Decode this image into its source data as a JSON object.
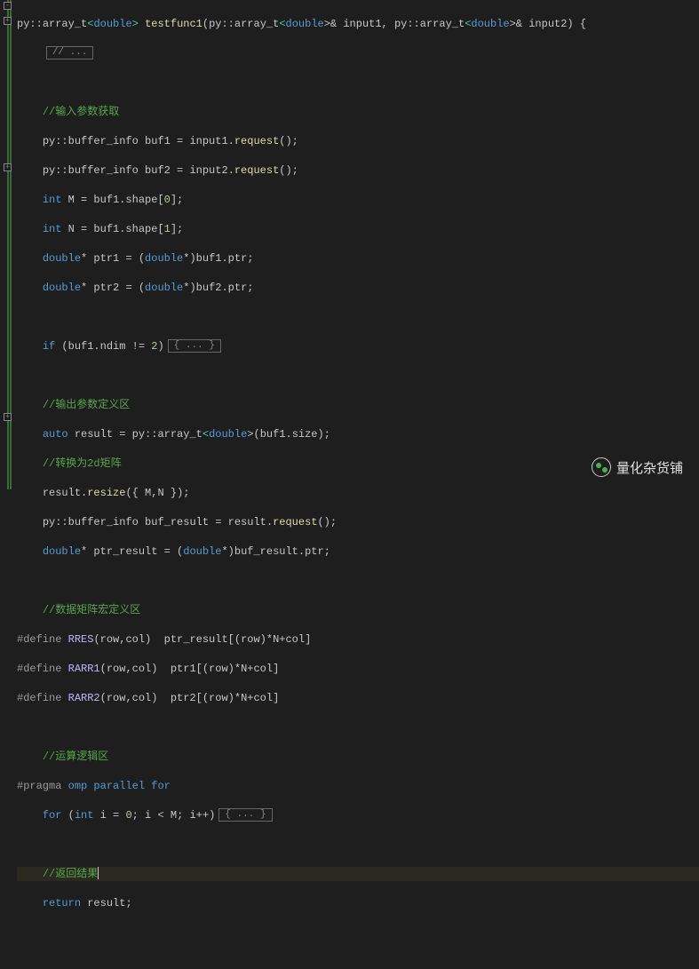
{
  "gutter": {
    "fold_open": "-",
    "fold_closed": "+"
  },
  "collapsed": {
    "ellipsis": "// ...",
    "brace_ellipsis": "{ ... }"
  },
  "code": {
    "l0": {
      "a": "py",
      "b": "::",
      "c": "array_t",
      "d": "<",
      "e": "double",
      "f": "> ",
      "g": "testfunc1",
      "h": "(py",
      "i": "::",
      "j": "array_t",
      "k": "<",
      "l": "double",
      "m": ">& input1, py",
      "n": "::",
      "o": "array_t",
      "p": "<",
      "q": "double",
      "r": ">& input2) {"
    },
    "c1": "//输入参数获取",
    "l4": {
      "a": "py",
      "b": "::",
      "c": "buffer_info buf1 = input1.",
      "d": "request",
      "e": "();"
    },
    "l5": {
      "a": "py",
      "b": "::",
      "c": "buffer_info buf2 = input2.",
      "d": "request",
      "e": "();"
    },
    "l6": {
      "a": "int",
      "b": " M = buf1.shape[",
      "c": "0",
      "d": "];"
    },
    "l7": {
      "a": "int",
      "b": " N = buf1.shape[",
      "c": "1",
      "d": "];"
    },
    "l8": {
      "a": "double",
      "b": "* ptr1 = (",
      "c": "double",
      "d": "*)buf1.ptr;"
    },
    "l9": {
      "a": "double",
      "b": "* ptr2 = (",
      "c": "double",
      "d": "*)buf2.ptr;"
    },
    "l11": {
      "a": "if",
      "b": " (buf1.ndim != ",
      "c": "2",
      "d": ")"
    },
    "c2": "//输出参数定义区",
    "l14": {
      "a": "auto",
      "b": " result = py",
      "c": "::",
      "d": "array_t",
      "e": "<",
      "f": "double",
      "g": ">(buf1.size);"
    },
    "c3": "//转换为2d矩阵",
    "l16": {
      "a": "result.",
      "b": "resize",
      "c": "({ M,N });"
    },
    "l17": {
      "a": "py",
      "b": "::",
      "c": "buffer_info buf_result = result.",
      "d": "request",
      "e": "();"
    },
    "l18": {
      "a": "double",
      "b": "* ptr_result = (",
      "c": "double",
      "d": "*)buf_result.ptr;"
    },
    "c4": "//数据矩阵宏定义区",
    "l21": {
      "a": "#define",
      "b": " ",
      "c": "RRES",
      "d": "(row,col)  ptr_result[(row)*N+col]"
    },
    "l22": {
      "a": "#define",
      "b": " ",
      "c": "RARR1",
      "d": "(row,col)  ptr1[(row)*N+col]"
    },
    "l23": {
      "a": "#define",
      "b": " ",
      "c": "RARR2",
      "d": "(row,col)  ptr2[(row)*N+col]"
    },
    "c5": "//运算逻辑区",
    "l26": {
      "a": "#pragma",
      "b": " ",
      "c": "omp parallel for"
    },
    "l27": {
      "a": "for",
      "b": " (",
      "c": "int",
      "d": " i = ",
      "e": "0",
      "f": "; i < M; i++)"
    },
    "c6": "//返回结果",
    "l30": {
      "a": "return",
      "b": " result;"
    }
  },
  "watermark": {
    "text": "量化杂货铺"
  }
}
